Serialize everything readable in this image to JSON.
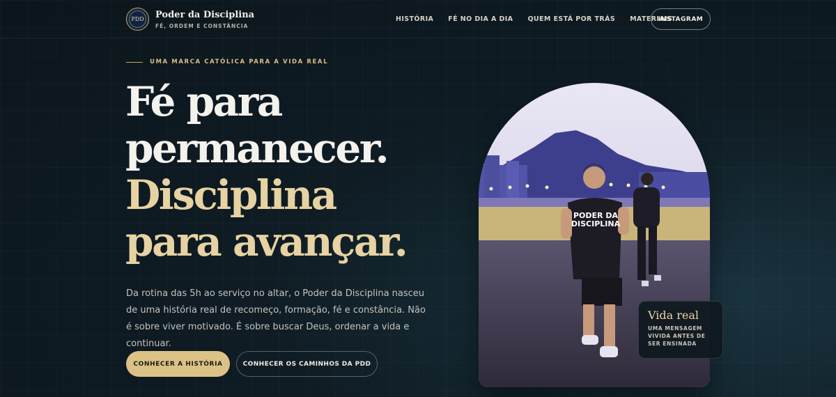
{
  "brand": {
    "logo_text": "PDD",
    "name": "Poder da Disciplina",
    "tagline": "FÉ, ORDEM E CONSTÂNCIA"
  },
  "nav": {
    "items": [
      "HISTÓRIA",
      "FÉ NO DIA A DIA",
      "QUEM ESTÁ POR TRÁS",
      "MATERIAIS"
    ],
    "cta": "INSTAGRAM"
  },
  "hero": {
    "eyebrow": "UMA MARCA CATÓLICA PARA A VIDA REAL",
    "headline": [
      "Fé para",
      "permanecer.",
      "Disciplina",
      "para avançar."
    ],
    "description": "Da rotina das 5h ao serviço no altar, o Poder da Disciplina nasceu de uma história real de recomeço, formação, fé e constância. Não é sobre viver motivado. É sobre buscar Deus, ordenar a vida e continuar.",
    "primary_button": "CONHECER A HISTÓRIA",
    "secondary_button": "CONHECER OS CAMINHOS DA PDD"
  },
  "photo": {
    "shirt_text": [
      "PODER DA",
      "DISCIPLINA"
    ]
  },
  "card": {
    "title": "Vida real",
    "text": [
      "UMA MENSAGEM",
      "VIVIDA ANTES DE",
      "SER ENSINADA"
    ]
  },
  "colors": {
    "background": "#0f1c24",
    "accent_gold": "#dcc287",
    "headline_gold": "#e6d2a2"
  }
}
